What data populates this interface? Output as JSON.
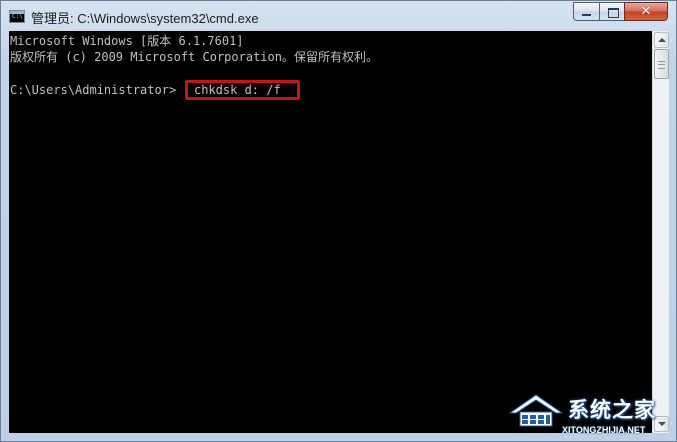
{
  "window": {
    "title": "管理员: C:\\Windows\\system32\\cmd.exe",
    "minimize_label": "minimize",
    "maximize_label": "maximize",
    "close_glyph": "✕"
  },
  "console": {
    "lines": [
      "Microsoft Windows [版本 6.1.7601]",
      "版权所有 (c) 2009 Microsoft Corporation。保留所有权利。",
      "",
      "C:\\Users\\Administrator>"
    ],
    "command": "chkdsk d: /f",
    "background_color": "#000000",
    "text_color": "#c0c0c0",
    "highlight_color": "#c0161c"
  },
  "watermark": {
    "title": "系统之家",
    "url": "XITONGZHIJIA.NET"
  },
  "icons": {
    "app": "cmd-app-icon",
    "scroll_up": "scroll-up-arrow-icon",
    "scroll_down": "scroll-down-arrow-icon"
  }
}
